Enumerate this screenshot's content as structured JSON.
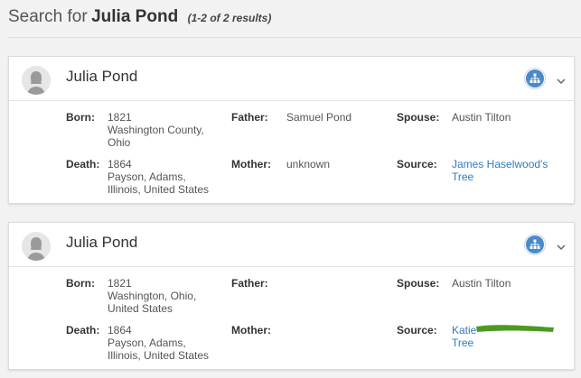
{
  "header": {
    "prefix": "Search for",
    "query_name": "Julia Pond",
    "count": "(1-2 of 2 results)"
  },
  "colors": {
    "accent": "#4a8ac9",
    "link": "#2f7bbf",
    "redaction": "#4a9a1f"
  },
  "results": [
    {
      "name": "Julia Pond",
      "born_label": "Born:",
      "born_year": "1821",
      "born_place": "Washington County, Ohio",
      "death_label": "Death:",
      "death_year": "1864",
      "death_place": "Payson, Adams, Illinois, United States",
      "father_label": "Father:",
      "father": "Samuel Pond",
      "mother_label": "Mother:",
      "mother": "unknown",
      "spouse_label": "Spouse:",
      "spouse": "Austin Tilton",
      "source_label": "Source:",
      "source": "James Haselwood's Tree"
    },
    {
      "name": "Julia Pond",
      "born_label": "Born:",
      "born_year": "1821",
      "born_place": "Washington, Ohio, United States",
      "death_label": "Death:",
      "death_year": "1864",
      "death_place": "Payson, Adams, Illinois, United States",
      "father_label": "Father:",
      "father": "",
      "mother_label": "Mother:",
      "mother": "",
      "spouse_label": "Spouse:",
      "spouse": "Austin Tilton",
      "source_label": "Source:",
      "source_start": "Katie",
      "source_end": "Tree"
    }
  ]
}
